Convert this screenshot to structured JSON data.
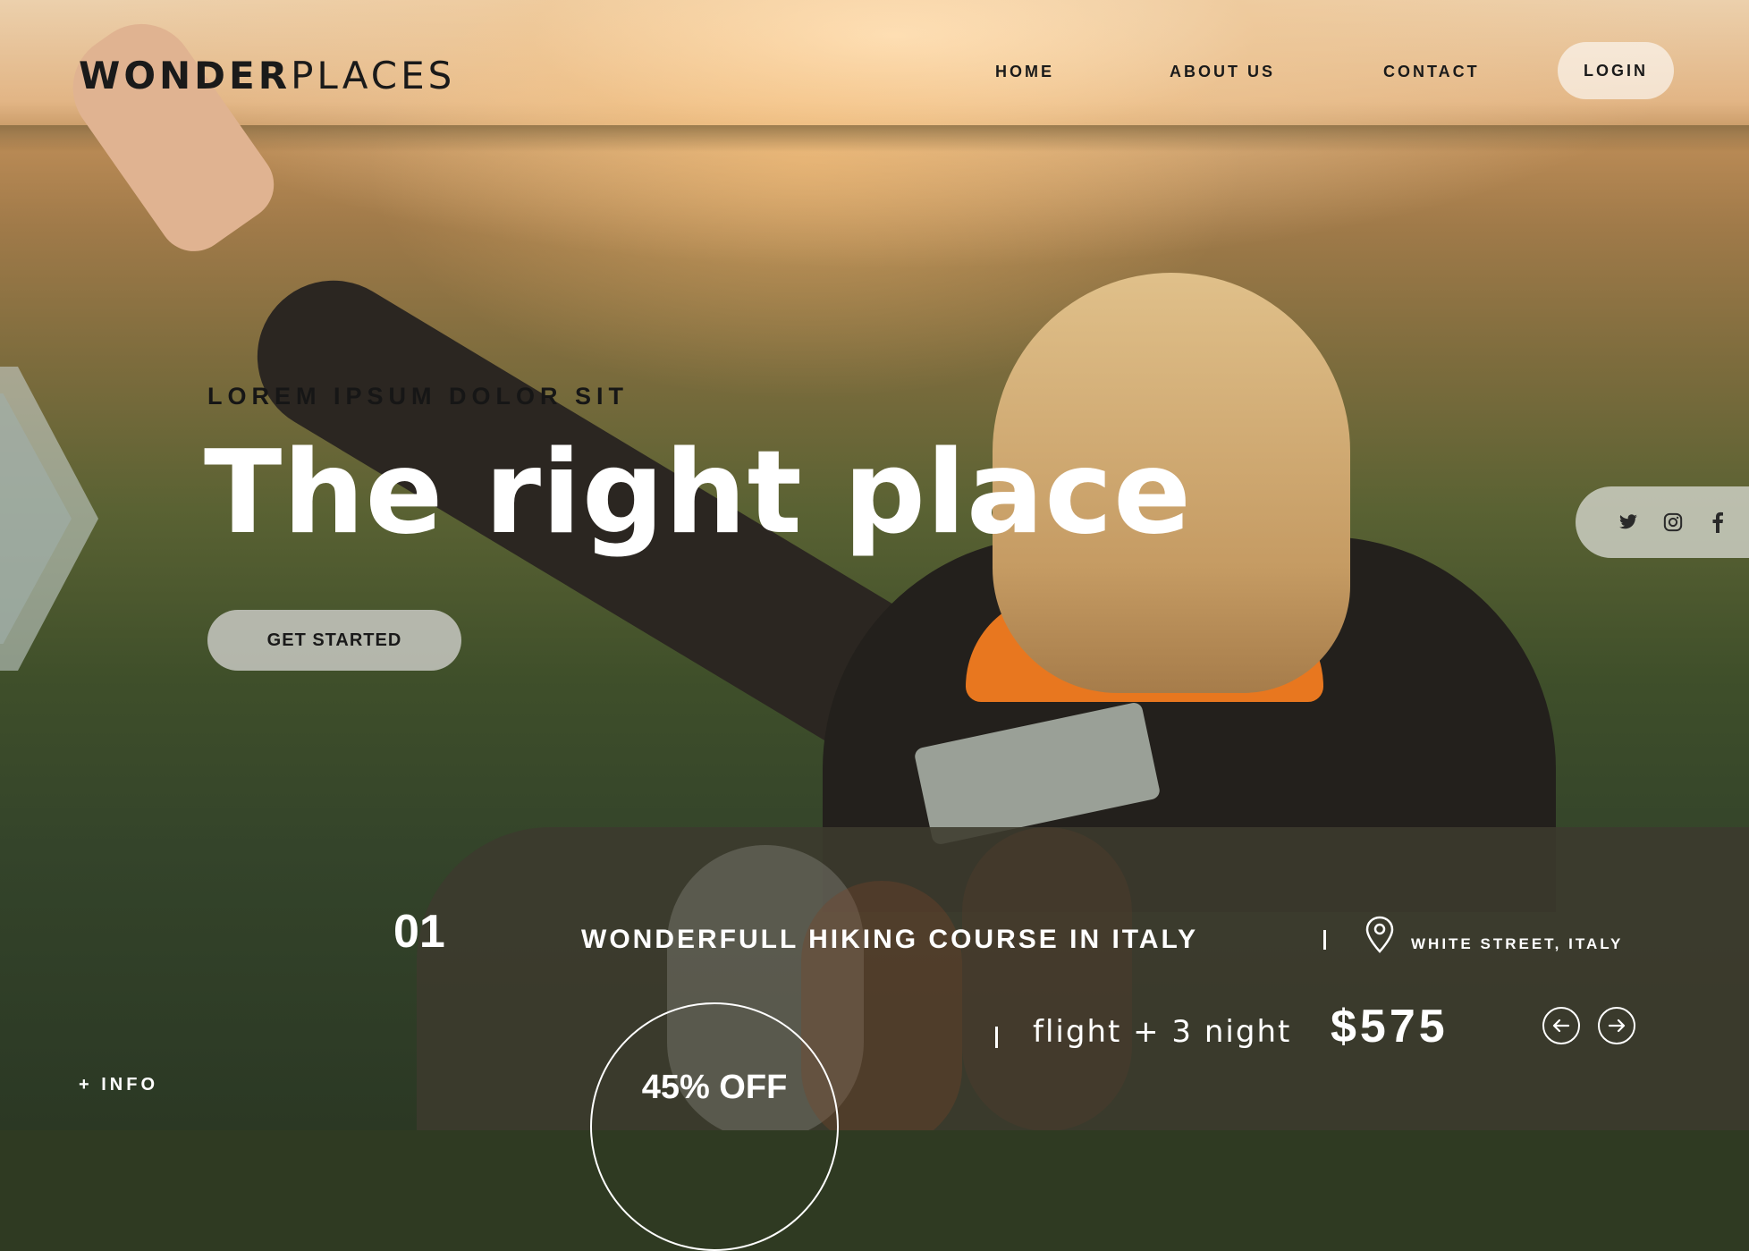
{
  "brand": {
    "name_bold": "WONDER",
    "name_light": "PLACES"
  },
  "nav": {
    "home": "HOME",
    "about": "ABOUT US",
    "contact": "CONTACT",
    "login": "LOGIN"
  },
  "hero": {
    "eyebrow": "LOREM IPSUM DOLOR SIT",
    "title": "The right place",
    "cta": "GET STARTED"
  },
  "social": [
    "twitter-icon",
    "instagram-icon",
    "facebook-icon"
  ],
  "info": {
    "label": "+ INFO"
  },
  "card": {
    "index": "01",
    "title": "WONDERFULL HIKING COURSE IN ITALY",
    "location": "WHITE STREET, ITALY",
    "package": "flight + 3 night",
    "price": "$575",
    "discount": "45% OFF"
  },
  "colors": {
    "text_dark": "#1a1a1a",
    "text_light": "#ffffff",
    "accent_orange": "#e8771f",
    "card_bg": "#3c3a2d"
  }
}
